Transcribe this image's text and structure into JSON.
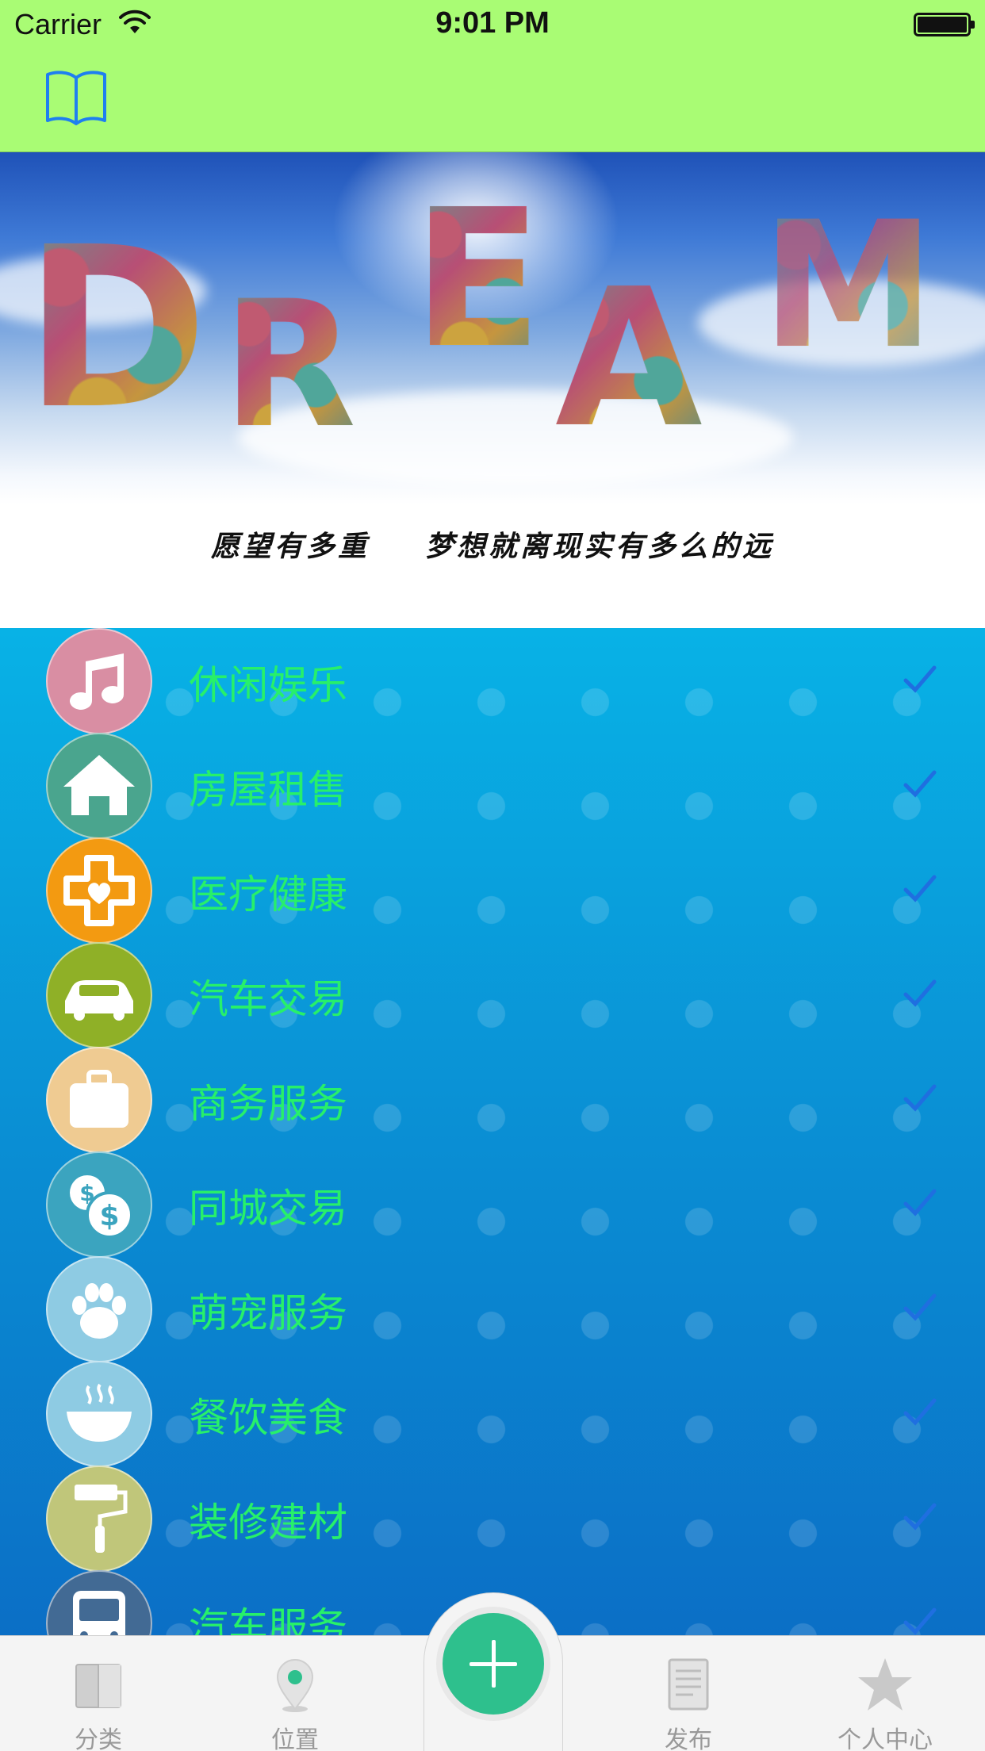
{
  "status_bar": {
    "carrier": "Carrier",
    "time": "9:01 PM"
  },
  "nav": {
    "left_icon": "book-icon"
  },
  "banner": {
    "letters": [
      "D",
      "R",
      "E",
      "A",
      "M"
    ],
    "slogan_left": "愿望有多重",
    "slogan_right": "梦想就离现实有多么的远"
  },
  "categories": [
    {
      "label": "休闲娱乐",
      "icon": "music-note-icon",
      "color": "#d98ea3"
    },
    {
      "label": "房屋租售",
      "icon": "house-icon",
      "color": "#4aa58e"
    },
    {
      "label": "医疗健康",
      "icon": "medical-cross-heart-icon",
      "color": "#f39a11"
    },
    {
      "label": "汽车交易",
      "icon": "car-icon",
      "color": "#8fb027"
    },
    {
      "label": "商务服务",
      "icon": "briefcase-icon",
      "color": "#efcb92"
    },
    {
      "label": "同城交易",
      "icon": "dollar-coins-icon",
      "color": "#3ba4bf"
    },
    {
      "label": "萌宠服务",
      "icon": "paw-icon",
      "color": "#8ecbe3"
    },
    {
      "label": "餐饮美食",
      "icon": "bowl-icon",
      "color": "#8ecbe3"
    },
    {
      "label": "装修建材",
      "icon": "paint-roller-icon",
      "color": "#c0c67a"
    },
    {
      "label": "汽车服务",
      "icon": "bus-icon",
      "color": "#426a94"
    }
  ],
  "tabs": [
    {
      "label": "分类",
      "icon": "book-tab-icon"
    },
    {
      "label": "位置",
      "icon": "location-pin-icon",
      "active": true
    },
    {
      "label": "",
      "icon": "plus-icon"
    },
    {
      "label": "发布",
      "icon": "document-icon"
    },
    {
      "label": "个人中心",
      "icon": "star-icon"
    }
  ],
  "colors": {
    "nav_bg": "#a9fc74",
    "label_green": "#27f06a",
    "check_blue": "#1f6fe0",
    "fab": "#2ec08d"
  }
}
